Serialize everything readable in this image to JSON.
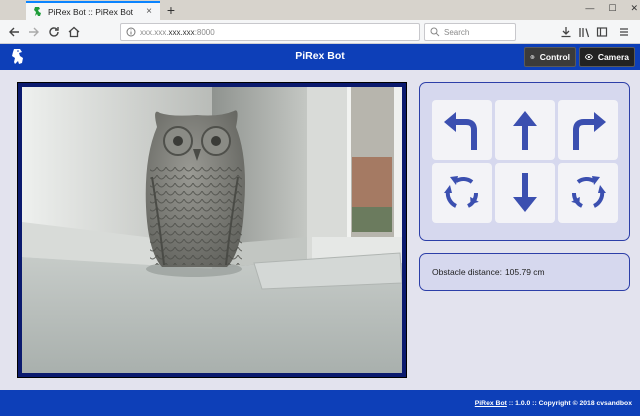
{
  "browser": {
    "tab_title": "PiRex Bot :: PiRex Bot",
    "tab_close": "×",
    "new_tab": "+",
    "url_prefix": "xxx.xxx.",
    "url_host": "xxx.xxx",
    "url_port": ":8000",
    "search_placeholder": "Search",
    "window_controls": [
      "—",
      "☐",
      "✕"
    ]
  },
  "header": {
    "title": "PiRex Bot",
    "control_label": "Control",
    "camera_label": "Camera"
  },
  "controls": {
    "buttons": [
      "turn-left",
      "forward",
      "turn-right",
      "rotate-left",
      "backward",
      "rotate-right"
    ]
  },
  "status": {
    "obstacle_label": "Obstacle distance:",
    "obstacle_value": "105.79 cm"
  },
  "footer": {
    "link": "PiRex Bot",
    "text": " :: 1.0.0 :: Copyright © 2018 cvsandbox"
  },
  "colors": {
    "brand_blue": "#0d3fb8",
    "panel_bg": "#d6d8ee",
    "arrow_blue": "#3b4fb0"
  }
}
